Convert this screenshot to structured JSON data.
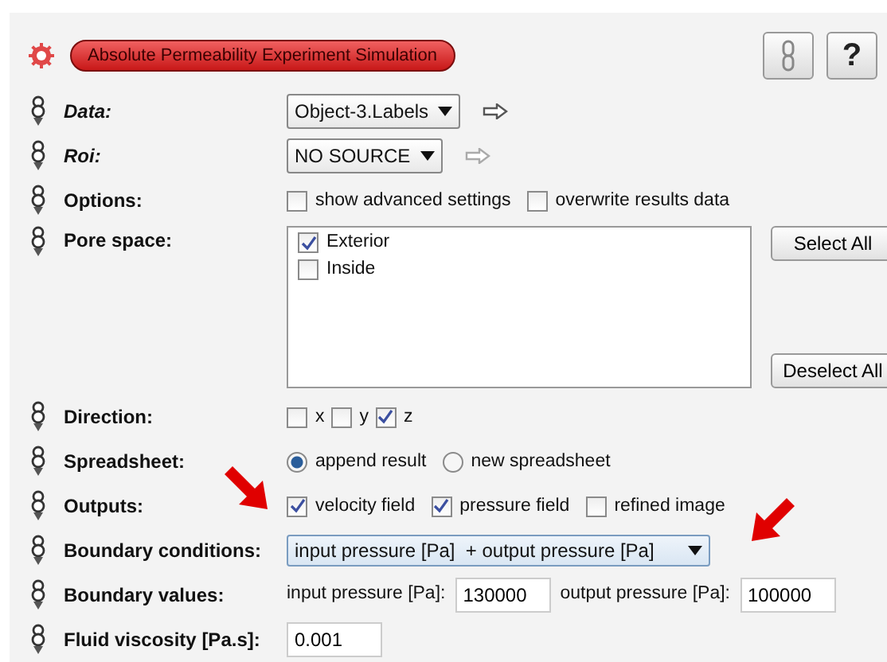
{
  "title": "Absolute Permeability Experiment Simulation",
  "help_buttons": [
    {
      "kind": "link"
    },
    {
      "kind": "help",
      "label": "?"
    }
  ],
  "ports": [
    {
      "kind": "dropdown",
      "label": "Data:",
      "italic": true,
      "value": "Object-3.Labels",
      "connected": true
    },
    {
      "kind": "dropdown",
      "label": "Roi:",
      "italic": true,
      "value": "NO SOURCE",
      "connected": false
    },
    {
      "kind": "checks",
      "label": "Options:",
      "items": [
        {
          "label": "show advanced settings",
          "checked": false
        },
        {
          "label": "overwrite results data",
          "checked": false
        }
      ]
    },
    {
      "kind": "listbox",
      "label": "Pore space:",
      "items": [
        {
          "label": "Exterior",
          "checked": true
        },
        {
          "label": "Inside",
          "checked": false
        }
      ],
      "buttons": [
        "Select All",
        "Deselect All"
      ]
    },
    {
      "kind": "checks",
      "label": "Direction:",
      "items": [
        {
          "label": "x",
          "checked": false
        },
        {
          "label": "y",
          "checked": false
        },
        {
          "label": "z",
          "checked": true
        }
      ]
    },
    {
      "kind": "radios",
      "label": "Spreadsheet:",
      "items": [
        {
          "label": "append result",
          "selected": true
        },
        {
          "label": "new spreadsheet",
          "selected": false
        }
      ]
    },
    {
      "kind": "checks",
      "label": "Outputs:",
      "annotated": true,
      "items": [
        {
          "label": "velocity field",
          "checked": true
        },
        {
          "label": "pressure field",
          "checked": true
        },
        {
          "label": "refined image",
          "checked": false
        }
      ]
    },
    {
      "kind": "combo",
      "label": "Boundary conditions:",
      "annotated": true,
      "value": "input pressure [Pa]  + output pressure [Pa]"
    },
    {
      "kind": "fields",
      "label": "Boundary values:",
      "items": [
        {
          "label": "input pressure [Pa]:",
          "value": "130000"
        },
        {
          "label": "output pressure [Pa]:",
          "value": "100000"
        }
      ]
    },
    {
      "kind": "fields",
      "label": "Fluid viscosity [Pa.s]:",
      "items": [
        {
          "value": "0.001"
        }
      ]
    }
  ]
}
